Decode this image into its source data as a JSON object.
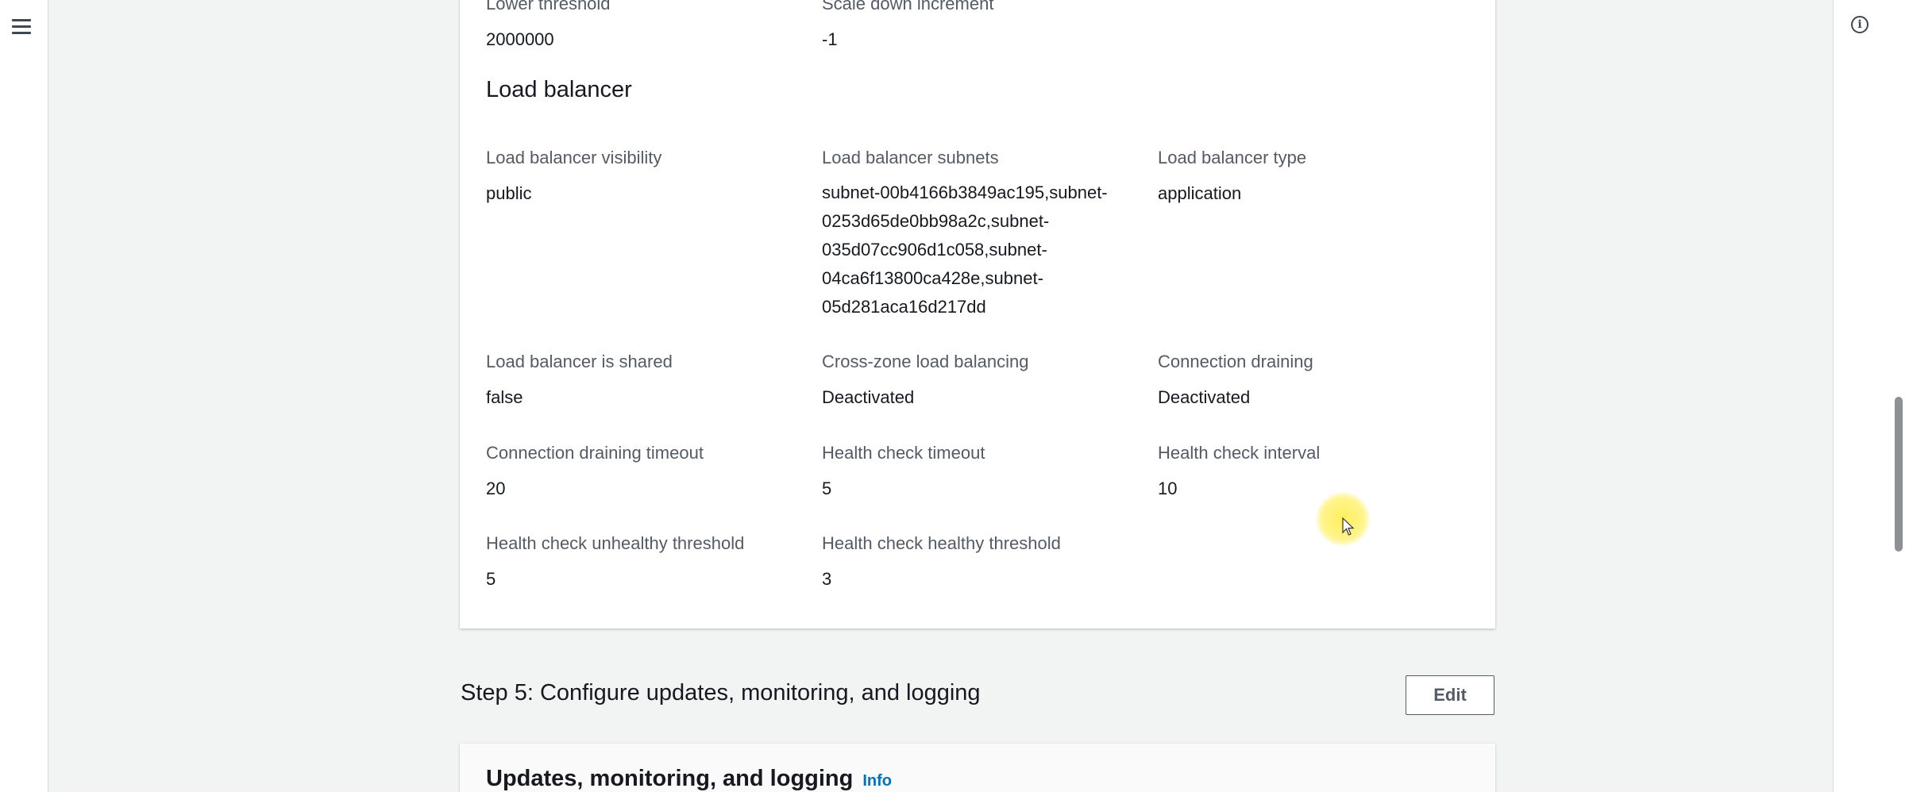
{
  "nav": {
    "menu_icon": "hamburger-menu-icon",
    "info_icon_glyph": "i"
  },
  "scaling": {
    "lower_threshold_label": "Lower threshold",
    "lower_threshold_value": "2000000",
    "scale_down_label": "Scale down increment",
    "scale_down_value": "-1"
  },
  "load_balancer": {
    "heading": "Load balancer",
    "fields": [
      {
        "label": "Load balancer visibility",
        "value": "public"
      },
      {
        "label": "Load balancer subnets",
        "value": "subnet-00b4166b3849ac195,subnet-\n0253d65de0bb98a2c,subnet-\n035d07cc906d1c058,subnet-\n04ca6f13800ca428e,subnet-\n05d281aca16d217dd"
      },
      {
        "label": "Load balancer type",
        "value": "application"
      },
      {
        "label": "Load balancer is shared",
        "value": "false"
      },
      {
        "label": "Cross-zone load balancing",
        "value": "Deactivated"
      },
      {
        "label": "Connection draining",
        "value": "Deactivated"
      },
      {
        "label": "Connection draining timeout",
        "value": "20"
      },
      {
        "label": "Health check timeout",
        "value": "5"
      },
      {
        "label": "Health check interval",
        "value": "10"
      },
      {
        "label": "Health check unhealthy threshold",
        "value": "5"
      },
      {
        "label": "Health check healthy threshold",
        "value": "3"
      }
    ]
  },
  "step5": {
    "title": "Step 5: Configure updates, monitoring, and logging",
    "edit_label": "Edit",
    "section_title": "Updates, monitoring, and logging",
    "info_link": "Info"
  },
  "colors": {
    "background": "#f2f3f3",
    "card": "#ffffff",
    "label": "#545b64",
    "value": "#16191f",
    "link": "#0073bb"
  }
}
